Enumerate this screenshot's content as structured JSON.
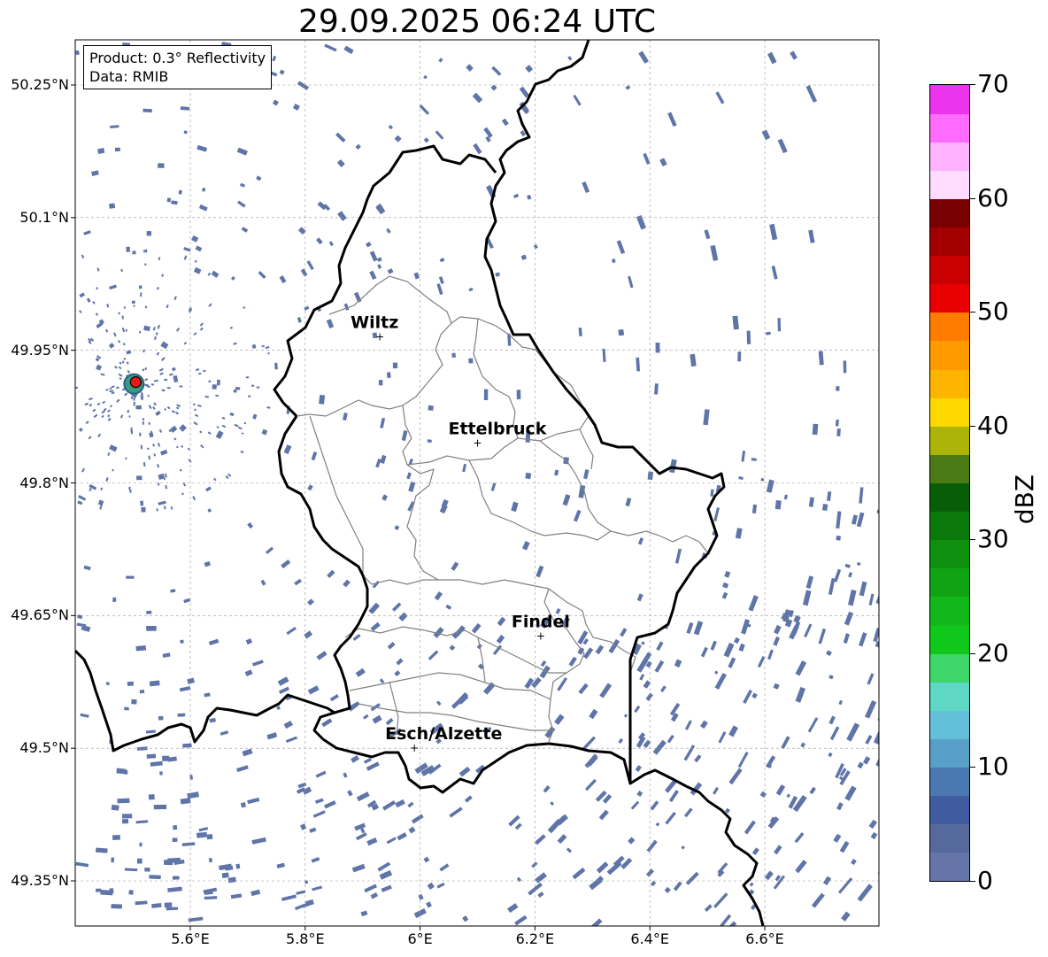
{
  "title": "29.09.2025 06:24 UTC",
  "info": {
    "product_line": "Product: 0.3° Reflectivity",
    "data_line": "Data: RMIB"
  },
  "map": {
    "lon_range": [
      5.4,
      6.8
    ],
    "lat_range": [
      49.3,
      50.3
    ],
    "lat_ticks": [
      {
        "value": 50.25,
        "label": "50.25°N"
      },
      {
        "value": 50.1,
        "label": "50.1°N"
      },
      {
        "value": 49.95,
        "label": "49.95°N"
      },
      {
        "value": 49.8,
        "label": "49.8°N"
      },
      {
        "value": 49.65,
        "label": "49.65°N"
      },
      {
        "value": 49.5,
        "label": "49.5°N"
      },
      {
        "value": 49.35,
        "label": "49.35°N"
      }
    ],
    "lon_ticks": [
      {
        "value": 5.6,
        "label": "5.6°E"
      },
      {
        "value": 5.8,
        "label": "5.8°E"
      },
      {
        "value": 6.0,
        "label": "6°E"
      },
      {
        "value": 6.2,
        "label": "6.2°E"
      },
      {
        "value": 6.4,
        "label": "6.4°E"
      },
      {
        "value": 6.6,
        "label": "6.6°E"
      }
    ],
    "grid": true,
    "cities": [
      {
        "name": "Wiltz",
        "lon": 5.93,
        "lat": 49.965
      },
      {
        "name": "Ettelbruck",
        "lon": 6.1,
        "lat": 49.845
      },
      {
        "name": "Findel",
        "lon": 6.21,
        "lat": 49.627
      },
      {
        "name": "Esch/Alzette",
        "lon": 5.99,
        "lat": 49.5
      }
    ],
    "radar_site": {
      "lon": 5.505,
      "lat": 49.914
    }
  },
  "colorbar": {
    "unit": "dBZ",
    "min": 0,
    "max": 70,
    "ticks": [
      "0",
      "10",
      "20",
      "30",
      "40",
      "50",
      "60",
      "70"
    ],
    "colors": [
      "#6575a8",
      "#55699c",
      "#415ba0",
      "#4a78b0",
      "#58a0c8",
      "#64c0d8",
      "#5ed8c4",
      "#3ed66a",
      "#10c81c",
      "#12b81a",
      "#10a414",
      "#0e900e",
      "#0a780a",
      "#085e08",
      "#4a7a14",
      "#acb408",
      "#ffd800",
      "#ffb400",
      "#ff9a00",
      "#ff7c00",
      "#e80000",
      "#c80000",
      "#a20000",
      "#780000",
      "#ffdcff",
      "#ffb2ff",
      "#ff6cff",
      "#ec34ec"
    ]
  },
  "echo_color": "#5f75a8"
}
